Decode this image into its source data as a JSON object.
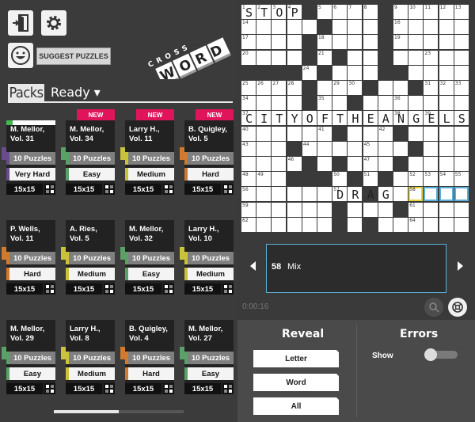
{
  "left": {
    "suggest_label": "SUGGEST PUZZLES",
    "logo_word_top": "CROSS",
    "logo_word_bottom": "WORD",
    "tab_packs": "Packs",
    "tab_ready": "Ready ▾",
    "new_badge": "NEW",
    "packs": [
      {
        "title1": "M. Mellor,",
        "title2": "Vol. 31",
        "count": "10 Puzzles",
        "difficulty": "Very Hard",
        "size": "15x15",
        "is_new": false,
        "progress": true,
        "accent": "#6a4b8c"
      },
      {
        "title1": "M. Mellor,",
        "title2": "Vol. 34",
        "count": "10 Puzzles",
        "difficulty": "Easy",
        "size": "15x15",
        "is_new": true,
        "progress": false,
        "accent": "#5aa067"
      },
      {
        "title1": "Larry H.,",
        "title2": "Vol. 11",
        "count": "10 Puzzles",
        "difficulty": "Medium",
        "size": "15x15",
        "is_new": true,
        "progress": false,
        "accent": "#c9c23a"
      },
      {
        "title1": "B. Quigley,",
        "title2": "Vol. 5",
        "count": "10 Puzzles",
        "difficulty": "Hard",
        "size": "15x15",
        "is_new": true,
        "progress": false,
        "accent": "#cf7a2e"
      },
      {
        "title1": "P. Wells,",
        "title2": "Vol. 11",
        "count": "10 Puzzles",
        "difficulty": "Hard",
        "size": "15x15",
        "is_new": false,
        "progress": false,
        "accent": "#cf7a2e"
      },
      {
        "title1": "A. Ries,",
        "title2": "Vol. 5",
        "count": "10 Puzzles",
        "difficulty": "Medium",
        "size": "15x15",
        "is_new": false,
        "progress": false,
        "accent": "#c9c23a"
      },
      {
        "title1": "M. Mellor,",
        "title2": "Vol. 32",
        "count": "10 Puzzles",
        "difficulty": "Easy",
        "size": "15x15",
        "is_new": false,
        "progress": false,
        "accent": "#5aa067"
      },
      {
        "title1": "Larry H.,",
        "title2": "Vol. 10",
        "count": "10 Puzzles",
        "difficulty": "Medium",
        "size": "15x15",
        "is_new": false,
        "progress": false,
        "accent": "#c9c23a"
      },
      {
        "title1": "M. Mellor,",
        "title2": "Vol. 29",
        "count": "10 Puzzles",
        "difficulty": "Easy",
        "size": "15x15",
        "is_new": false,
        "progress": false,
        "accent": "#5aa067"
      },
      {
        "title1": "Larry H.,",
        "title2": "Vol. 8",
        "count": "10 Puzzles",
        "difficulty": "Medium",
        "size": "15x15",
        "is_new": false,
        "progress": false,
        "accent": "#c9c23a"
      },
      {
        "title1": "B. Quigley,",
        "title2": "Vol. 4",
        "count": "10 Puzzles",
        "difficulty": "Hard",
        "size": "15x15",
        "is_new": false,
        "progress": false,
        "accent": "#cf7a2e"
      },
      {
        "title1": "M. Mellor,",
        "title2": "Vol. 27",
        "count": "10 Puzzles",
        "difficulty": "Easy",
        "size": "15x15",
        "is_new": false,
        "progress": false,
        "accent": "#5aa067"
      }
    ]
  },
  "puzzle": {
    "rows": [
      "....#....#.....",
      ".....#...#.....",
      "....#....#.....",
      "....#.#..#.....",
      "####.#...##....",
      "....#...#..#...",
      "....#..#.......",
      "...............",
      "......#...#....",
      "...#.......#...",
      "....#.#...#....",
      "...###.#.#.....",
      "........#......",
      "......#...#....",
      "......#.#......"
    ],
    "numbers": [
      {
        "r": 0,
        "c": 0,
        "n": "1"
      },
      {
        "r": 0,
        "c": 1,
        "n": "2"
      },
      {
        "r": 0,
        "c": 2,
        "n": "3"
      },
      {
        "r": 0,
        "c": 3,
        "n": "4"
      },
      {
        "r": 0,
        "c": 5,
        "n": "5"
      },
      {
        "r": 0,
        "c": 6,
        "n": "6"
      },
      {
        "r": 0,
        "c": 7,
        "n": "7"
      },
      {
        "r": 0,
        "c": 8,
        "n": "8"
      },
      {
        "r": 0,
        "c": 10,
        "n": "9"
      },
      {
        "r": 0,
        "c": 11,
        "n": "10"
      },
      {
        "r": 0,
        "c": 12,
        "n": "11"
      },
      {
        "r": 0,
        "c": 13,
        "n": "12"
      },
      {
        "r": 0,
        "c": 14,
        "n": "13"
      },
      {
        "r": 1,
        "c": 0,
        "n": "14"
      },
      {
        "r": 1,
        "c": 5,
        "n": "15"
      },
      {
        "r": 1,
        "c": 10,
        "n": "16"
      },
      {
        "r": 2,
        "c": 0,
        "n": "17"
      },
      {
        "r": 2,
        "c": 5,
        "n": "18"
      },
      {
        "r": 2,
        "c": 10,
        "n": "19"
      },
      {
        "r": 3,
        "c": 0,
        "n": "20"
      },
      {
        "r": 3,
        "c": 5,
        "n": "21"
      },
      {
        "r": 3,
        "c": 9,
        "n": "22"
      },
      {
        "r": 3,
        "c": 12,
        "n": "23"
      },
      {
        "r": 4,
        "c": 4,
        "n": "24"
      },
      {
        "r": 5,
        "c": 0,
        "n": "25"
      },
      {
        "r": 5,
        "c": 1,
        "n": "26"
      },
      {
        "r": 5,
        "c": 2,
        "n": "27"
      },
      {
        "r": 5,
        "c": 3,
        "n": "28"
      },
      {
        "r": 5,
        "c": 6,
        "n": "29"
      },
      {
        "r": 5,
        "c": 7,
        "n": "30"
      },
      {
        "r": 5,
        "c": 12,
        "n": "31"
      },
      {
        "r": 5,
        "c": 13,
        "n": "32"
      },
      {
        "r": 5,
        "c": 14,
        "n": "33"
      },
      {
        "r": 6,
        "c": 0,
        "n": "34"
      },
      {
        "r": 6,
        "c": 5,
        "n": "35"
      },
      {
        "r": 6,
        "c": 10,
        "n": "36"
      },
      {
        "r": 7,
        "c": 0,
        "n": "37"
      },
      {
        "r": 7,
        "c": 10,
        "n": "38"
      },
      {
        "r": 7,
        "c": 12,
        "n": "39"
      },
      {
        "r": 8,
        "c": 0,
        "n": "40"
      },
      {
        "r": 8,
        "c": 5,
        "n": "41"
      },
      {
        "r": 8,
        "c": 9,
        "n": "42"
      },
      {
        "r": 9,
        "c": 0,
        "n": "43"
      },
      {
        "r": 9,
        "c": 4,
        "n": "44"
      },
      {
        "r": 9,
        "c": 8,
        "n": "45"
      },
      {
        "r": 10,
        "c": 3,
        "n": "46"
      },
      {
        "r": 10,
        "c": 8,
        "n": "47"
      },
      {
        "r": 11,
        "c": 0,
        "n": "48"
      },
      {
        "r": 11,
        "c": 1,
        "n": "49"
      },
      {
        "r": 11,
        "c": 6,
        "n": "50"
      },
      {
        "r": 11,
        "c": 8,
        "n": "51"
      },
      {
        "r": 11,
        "c": 11,
        "n": "52"
      },
      {
        "r": 11,
        "c": 12,
        "n": "53"
      },
      {
        "r": 11,
        "c": 13,
        "n": "54"
      },
      {
        "r": 11,
        "c": 14,
        "n": "55"
      },
      {
        "r": 12,
        "c": 0,
        "n": "56"
      },
      {
        "r": 12,
        "c": 6,
        "n": "57"
      },
      {
        "r": 12,
        "c": 11,
        "n": "58"
      },
      {
        "r": 13,
        "c": 0,
        "n": "59"
      },
      {
        "r": 13,
        "c": 6,
        "n": "60"
      },
      {
        "r": 13,
        "c": 11,
        "n": "61"
      },
      {
        "r": 14,
        "c": 0,
        "n": "62"
      },
      {
        "r": 14,
        "c": 6,
        "n": "63"
      },
      {
        "r": 14,
        "c": 11,
        "n": "64"
      }
    ],
    "letters": [
      {
        "r": 0,
        "c": 0,
        "l": "S"
      },
      {
        "r": 0,
        "c": 1,
        "l": "T"
      },
      {
        "r": 0,
        "c": 2,
        "l": "O"
      },
      {
        "r": 0,
        "c": 3,
        "l": "P"
      },
      {
        "r": 7,
        "c": 0,
        "l": "C"
      },
      {
        "r": 7,
        "c": 1,
        "l": "I"
      },
      {
        "r": 7,
        "c": 2,
        "l": "T"
      },
      {
        "r": 7,
        "c": 3,
        "l": "Y"
      },
      {
        "r": 7,
        "c": 4,
        "l": "O"
      },
      {
        "r": 7,
        "c": 5,
        "l": "F"
      },
      {
        "r": 7,
        "c": 6,
        "l": "T"
      },
      {
        "r": 7,
        "c": 7,
        "l": "H"
      },
      {
        "r": 7,
        "c": 8,
        "l": "E"
      },
      {
        "r": 7,
        "c": 9,
        "l": "A"
      },
      {
        "r": 7,
        "c": 10,
        "l": "N"
      },
      {
        "r": 7,
        "c": 11,
        "l": "G"
      },
      {
        "r": 7,
        "c": 12,
        "l": "E"
      },
      {
        "r": 7,
        "c": 13,
        "l": "L"
      },
      {
        "r": 7,
        "c": 14,
        "l": "S"
      },
      {
        "r": 12,
        "c": 6,
        "l": "D"
      },
      {
        "r": 12,
        "c": 7,
        "l": "R"
      },
      {
        "r": 12,
        "c": 8,
        "l": "A"
      },
      {
        "r": 12,
        "c": 9,
        "l": "G"
      }
    ],
    "selected": {
      "r": 12,
      "c": 11
    },
    "highlighted": [
      {
        "r": 12,
        "c": 12
      },
      {
        "r": 12,
        "c": 13
      },
      {
        "r": 12,
        "c": 14
      }
    ],
    "colors": {
      "highlight": "#5ab0d8",
      "selected": "#e8d23a"
    }
  },
  "clue": {
    "number": "58",
    "text": "Mix"
  },
  "timer": "0:00:16",
  "reveal": {
    "heading": "Reveal",
    "letter": "Letter",
    "word": "Word",
    "all": "All"
  },
  "errors": {
    "heading": "Errors",
    "show_label": "Show",
    "show_enabled": false
  }
}
